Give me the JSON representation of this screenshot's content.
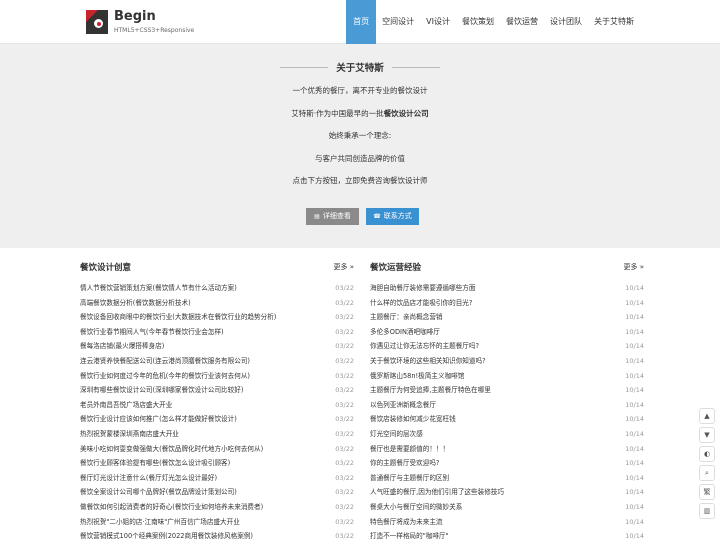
{
  "brand": {
    "name": "Begin",
    "tagline": "HTML5+CSS3+Responsive"
  },
  "nav": [
    "首页",
    "空间设计",
    "VI设计",
    "餐饮策划",
    "餐饮运营",
    "设计团队",
    "关于艾特斯"
  ],
  "hero": {
    "title": "关于艾特斯",
    "line1": "一个优秀的餐厅，离不开专业的餐饮设计",
    "line2_prefix": "艾特斯·作为中国最早的一批",
    "line2_bold": "餐饮设计公司",
    "line3": "始终秉承一个理念:",
    "line4": "与客户共同创造品牌的价值",
    "line5": "点击下方按钮，立即免费咨询餐饮设计师",
    "btn_detail": "详细查看",
    "btn_contact": "联系方式"
  },
  "left": {
    "title": "餐饮设计创意",
    "more": "更多 »",
    "items": [
      {
        "t": "情人节餐饮营销策划方案(餐饮情人节有什么活动方案)",
        "d": "03/22"
      },
      {
        "t": "高端餐饮数据分析(餐饮数据分析技术)",
        "d": "03/22"
      },
      {
        "t": "餐饮设备回收商眼中的餐饮行业(大数据技术在餐饮行业的趋势分析)",
        "d": "03/22"
      },
      {
        "t": "餐饮行业春节期间人气(今年春节餐饮行业会怎样)",
        "d": "03/22"
      },
      {
        "t": "餐每洛店铺(最火爆搭棒身店)",
        "d": "03/22"
      },
      {
        "t": "连云港贤养快餐配送公司(连云港尚顶膳餐饮服务有限公司)",
        "d": "03/22"
      },
      {
        "t": "餐饮行业如何度过今年的危机(今年的餐饮行业该何去何从)",
        "d": "03/22"
      },
      {
        "t": "深圳有哪些餐饮设计公司(深圳哪家餐饮设计公司比较好)",
        "d": "03/22"
      },
      {
        "t": "老员外南昌吾悦广场店盛大开业",
        "d": "03/22"
      },
      {
        "t": "餐饮行业设计应该如何推广(怎么样才能做好餐饮设计)",
        "d": "03/22"
      },
      {
        "t": "热烈祝贺蒙楼深圳燕南店盛大开业",
        "d": "03/22"
      },
      {
        "t": "美味小吃如何耍变做强做大(餐饮品牌化时代地方小吃何去何从)",
        "d": "03/22"
      },
      {
        "t": "餐饮行业顾客体验提有哪些(餐饮怎么设计吸引顾客)",
        "d": "03/22"
      },
      {
        "t": "餐厅灯光设计注意什么(餐厅灯光怎么设计最好)",
        "d": "03/22"
      },
      {
        "t": "餐饮全案设计公司哪个品牌好(餐饮品牌设计策划公司)",
        "d": "03/22"
      },
      {
        "t": "做餐饮如何引起消费者的好奇心(餐饮行业如何培养未来消费者)",
        "d": "03/22"
      },
      {
        "t": "热烈祝贺\"二小姐的店·江南味\"广州百信广场店盛大开业",
        "d": "03/22"
      },
      {
        "t": "餐饮营销模式100个经典案例(2022商用餐饮装修风格案例)",
        "d": "03/22"
      }
    ]
  },
  "right": {
    "title": "餐饮运营经验",
    "more": "更多 »",
    "items": [
      {
        "t": "海胆自助餐厅装修需要遵循哪些方面",
        "d": "10/14"
      },
      {
        "t": "什么样的饮品店才能吸引你的目光?",
        "d": "10/14"
      },
      {
        "t": "主题餐厅：亲尚概念营销",
        "d": "10/14"
      },
      {
        "t": "多伦多ODIN酒吧咖啡厅",
        "d": "10/14"
      },
      {
        "t": "你遇见过让你无法忘怀的主题餐厅吗?",
        "d": "10/14"
      },
      {
        "t": "关于餐饮环境的这些相关知识你知道吗?",
        "d": "10/14"
      },
      {
        "t": "俄罗斯喀山58n!极简主义咖啡馆",
        "d": "10/14"
      },
      {
        "t": "主题餐厅为何受追捧,主题餐厅特色在哪里",
        "d": "10/14"
      },
      {
        "t": "以色列亚洲新概念餐厅",
        "d": "10/14"
      },
      {
        "t": "餐饮店装修如何减少花宽枉钱",
        "d": "10/14"
      },
      {
        "t": "灯光空间的层次感",
        "d": "10/14"
      },
      {
        "t": "餐厅也是需要颜值的！！！",
        "d": "10/14"
      },
      {
        "t": "你的主题餐厅受欢迎吗?",
        "d": "10/14"
      },
      {
        "t": "普通餐厅与主题餐厅的区别",
        "d": "10/14"
      },
      {
        "t": "人气旺盛的餐厅,因为他们引用了这些装修技巧",
        "d": "10/14"
      },
      {
        "t": "餐桌大小与餐厅空间的微妙关系",
        "d": "10/14"
      },
      {
        "t": "特色餐厅将成为未来主流",
        "d": "10/14"
      },
      {
        "t": "打造不一样格局的\"咖啡厅\"",
        "d": "10/14"
      }
    ]
  },
  "tools": [
    "▲",
    "▼",
    "◐",
    "⌕",
    "繁",
    "▥"
  ]
}
